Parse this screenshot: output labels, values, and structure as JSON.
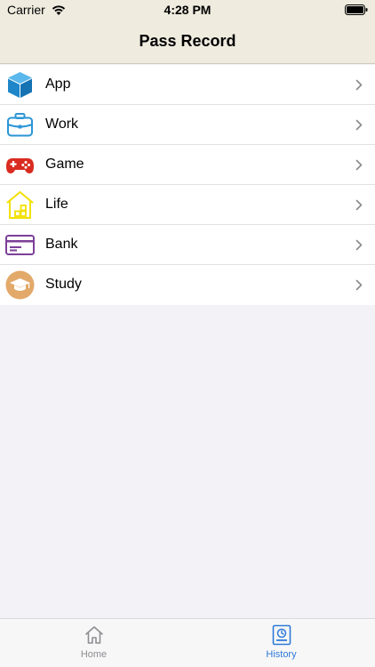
{
  "status_bar": {
    "carrier": "Carrier",
    "time": "4:28 PM"
  },
  "nav": {
    "title": "Pass Record"
  },
  "categories": [
    {
      "label": "App",
      "icon": "cube-icon",
      "color": "#2b95d6"
    },
    {
      "label": "Work",
      "icon": "briefcase-icon",
      "color": "#2b95d6"
    },
    {
      "label": "Game",
      "icon": "gamepad-icon",
      "color": "#d92b21"
    },
    {
      "label": "Life",
      "icon": "house-icon",
      "color": "#f3e000"
    },
    {
      "label": "Bank",
      "icon": "card-icon",
      "color": "#7d3f98"
    },
    {
      "label": "Study",
      "icon": "graduation-cap-icon",
      "color": "#e2a96a"
    }
  ],
  "tabbar": {
    "home_label": "Home",
    "history_label": "History",
    "active_color": "#2f7ad8",
    "inactive_color": "#8e8e93"
  }
}
